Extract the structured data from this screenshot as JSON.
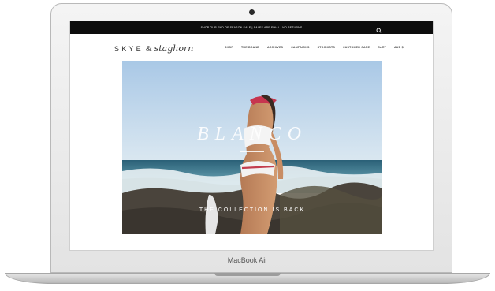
{
  "device": {
    "model_label": "MacBook Air"
  },
  "site": {
    "announcement": "SHOP OUR END OF SEASON SALE | SALES ARE FINAL | NO RETURNS",
    "logo_word1": "SKYE",
    "logo_amp": "&",
    "logo_word2": "staghorn",
    "nav": [
      "SHOP",
      "THE BRAND",
      "ARCHIVES",
      "CAMPAIGNS",
      "STOCKISTS",
      "CUSTOMER CARE",
      "CART",
      "AUD"
    ],
    "nav_currency_symbol": "$",
    "hero": {
      "title": "BLANCO",
      "subtitle": "THE COLLECTION IS BACK"
    }
  },
  "colors": {
    "announcement_bg": "#0d0d0d",
    "sky_top": "#b9d3ea",
    "sea": "#2f6f86",
    "rock": "#3e3a34"
  },
  "icons": {
    "search": "search-icon",
    "camera": "camera-icon"
  }
}
